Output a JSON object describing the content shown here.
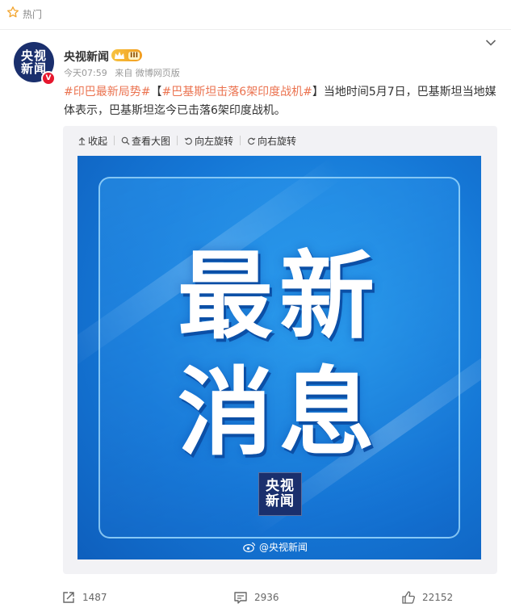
{
  "hot_bar": {
    "label": "热门",
    "icon": "star-outline-icon"
  },
  "post": {
    "author": {
      "name": "央视新闻",
      "avatar_text": [
        "央视",
        "新闻"
      ],
      "verified_badge": "V",
      "level_badge": "III"
    },
    "meta": {
      "time": "今天07:59",
      "source": "来自 微博网页版"
    },
    "text": {
      "hashtag1": "#印巴最新局势#",
      "bracket_open": "【",
      "hashtag2": "#巴基斯坦击落6架印度战机#",
      "bracket_close": "】",
      "body": "当地时间5月7日，巴基斯坦当地媒体表示，巴基斯坦迄今已击落6架印度战机。"
    },
    "toolbar": {
      "collapse": "收起",
      "view_large": "查看大图",
      "rotate_left": "向左旋转",
      "rotate_right": "向右旋转"
    },
    "image": {
      "line1": "最新",
      "line2": "消息",
      "logo": [
        "央视",
        "新闻"
      ],
      "watermark": "@央视新闻"
    },
    "actions": {
      "reposts": "1487",
      "comments": "2936",
      "likes": "22152"
    }
  },
  "colors": {
    "hashtag": "#eb7350",
    "image_blue": "#1577d6",
    "verified_red": "#e6162d"
  }
}
